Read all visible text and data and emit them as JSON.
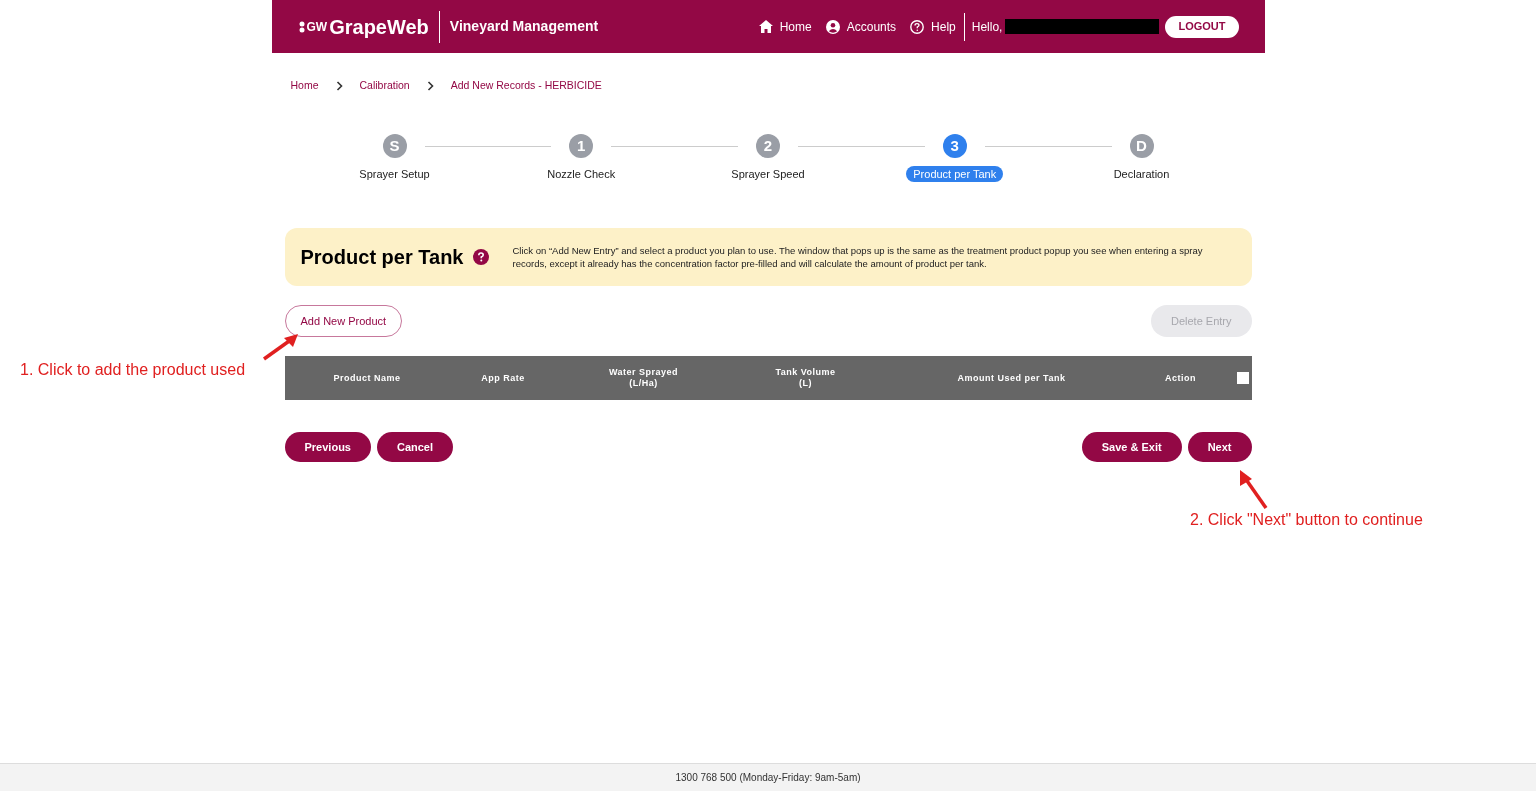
{
  "header": {
    "logo_mark": "GW",
    "logo": "GrapeWeb",
    "subtitle": "Vineyard Management",
    "nav": [
      {
        "kind": "home",
        "label": "Home"
      },
      {
        "kind": "account",
        "label": "Accounts"
      },
      {
        "kind": "help",
        "label": "Help"
      }
    ],
    "greeting": "Hello,",
    "logout": "LOGOUT"
  },
  "breadcrumbs": [
    "Home",
    "Calibration",
    "Add New Records - HERBICIDE"
  ],
  "steps": [
    {
      "symbol": "S",
      "label": "Sprayer Setup",
      "selected": false
    },
    {
      "symbol": "1",
      "label": "Nozzle Check",
      "selected": false
    },
    {
      "symbol": "2",
      "label": "Sprayer Speed",
      "selected": false
    },
    {
      "symbol": "3",
      "label": "Product per Tank",
      "selected": true
    },
    {
      "symbol": "D",
      "label": "Declaration",
      "selected": false
    }
  ],
  "info": {
    "title": "Product per Tank",
    "text": "Click on “Add New Entry” and select a product you plan to use. The window that pops up is the same as the treatment product popup you see when entering a spray records, except it already has the concentration factor pre-filled and will calculate the amount of product per tank."
  },
  "add_button": "Add New Product",
  "delete_button": {
    "label": "Delete Entry",
    "disabled": true
  },
  "table": {
    "columns": [
      {
        "label": "Product Name"
      },
      {
        "label": "App Rate"
      },
      {
        "label": "Water Sprayed",
        "unit": "(L/Ha)"
      },
      {
        "label": "Tank Volume",
        "unit": "(L)"
      },
      {
        "label": "Amount Used per Tank"
      },
      {
        "label": "Action"
      }
    ],
    "select_all_checked": false
  },
  "left_buttons": [
    "Previous",
    "Cancel"
  ],
  "right_buttons": [
    "Save & Exit",
    "Next"
  ],
  "annotations": [
    "1. Click to add the product used",
    "2. Click \"Next\" button to continue"
  ],
  "footer": "1300 768 500 (Monday-Friday: 9am-5am)"
}
